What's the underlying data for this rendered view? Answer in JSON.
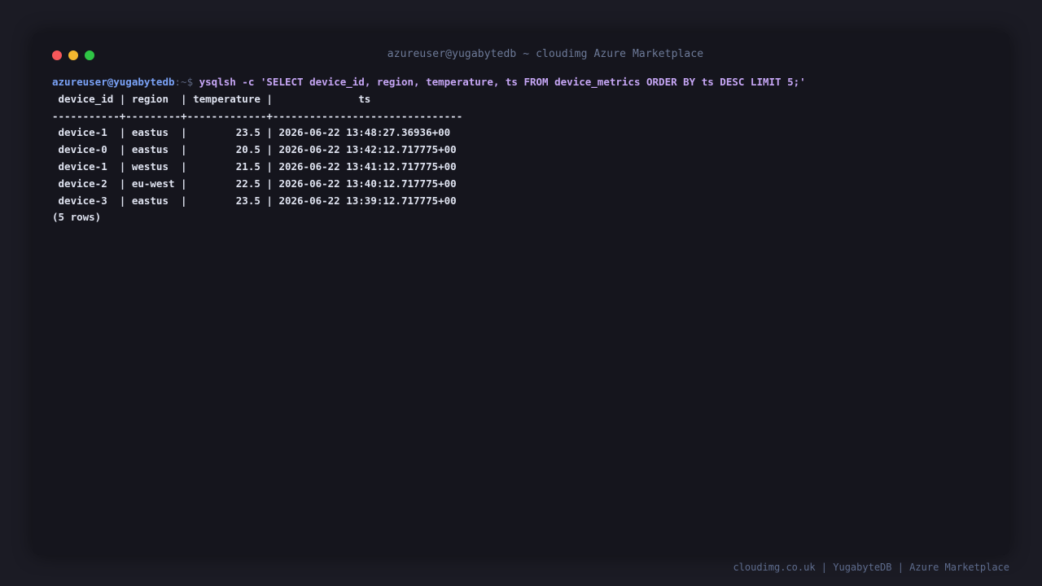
{
  "window": {
    "title": "azureuser@yugabytedb ~ cloudimg Azure Marketplace",
    "colors": {
      "close": "#f7575a",
      "minimize": "#f2b72f",
      "maximize": "#2fc545"
    }
  },
  "terminal": {
    "prompt_user": "azureuser@yugabytedb",
    "prompt_suffix": ":~$ ",
    "command": "ysqlsh -c 'SELECT device_id, region, temperature, ts FROM device_metrics ORDER BY ts DESC LIMIT 5;'",
    "table_header": " device_id | region  | temperature |              ts",
    "table_separator": "-----------+---------+-------------+-------------------------------",
    "rows": [
      " device-1  | eastus  |        23.5 | 2026-06-22 13:48:27.36936+00",
      " device-0  | eastus  |        20.5 | 2026-06-22 13:42:12.717775+00",
      " device-1  | westus  |        21.5 | 2026-06-22 13:41:12.717775+00",
      " device-2  | eu-west |        22.5 | 2026-06-22 13:40:12.717775+00",
      " device-3  | eastus  |        23.5 | 2026-06-22 13:39:12.717775+00"
    ],
    "row_count": "(5 rows)"
  },
  "footer": {
    "text": "cloudimg.co.uk | YugabyteDB | Azure Marketplace"
  }
}
